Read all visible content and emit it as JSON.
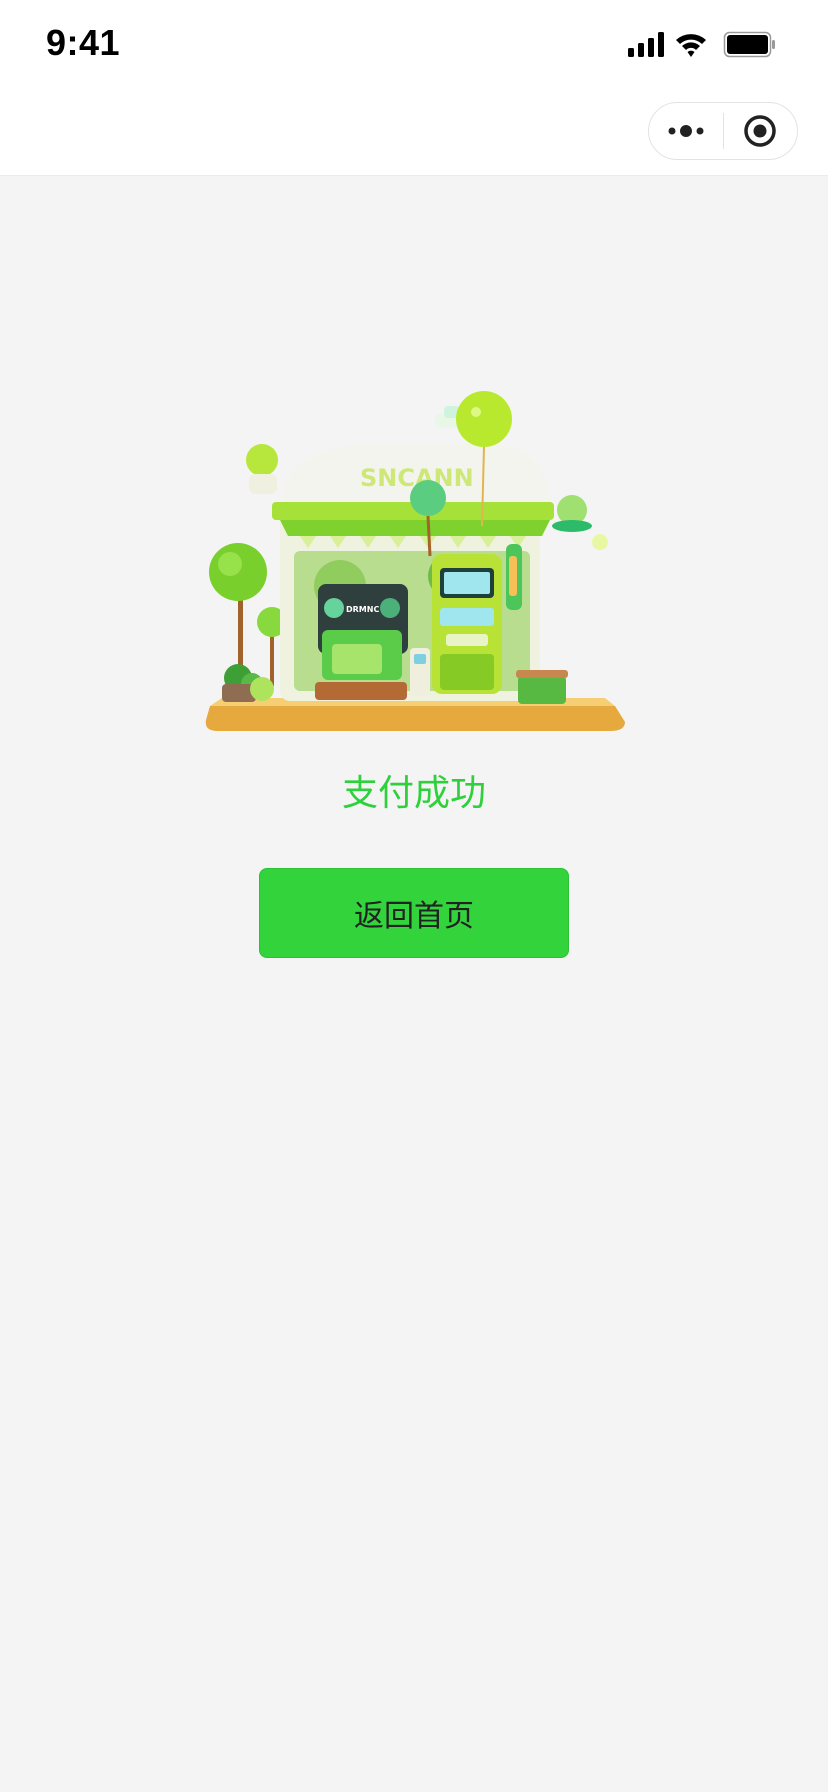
{
  "status_bar": {
    "time": "9:41",
    "icons": [
      "signal-icon",
      "wifi-icon",
      "battery-icon"
    ]
  },
  "capsule": {
    "icons": [
      "more-dots-icon",
      "close-target-icon"
    ]
  },
  "illustration": {
    "sign_text": "SNCANN",
    "screen_text": "DRMNC"
  },
  "result": {
    "title": "支付成功",
    "button_label": "返回首页"
  },
  "colors": {
    "accent": "#2ed13b",
    "button": "#33d33c",
    "background": "#f4f4f4"
  }
}
